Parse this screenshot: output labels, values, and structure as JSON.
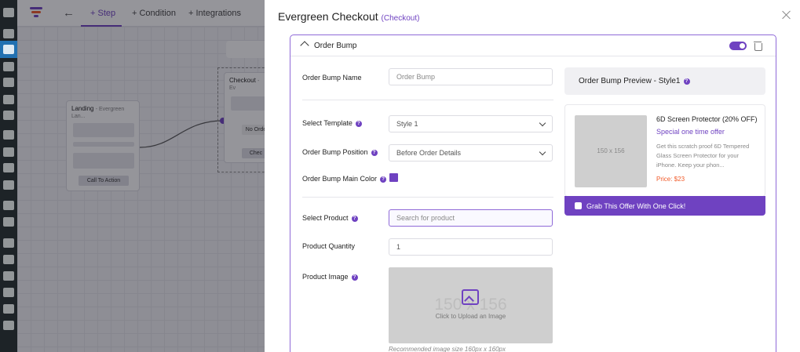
{
  "builder": {
    "tabs": [
      {
        "label": "+ Step",
        "active": true
      },
      {
        "label": "+ Condition",
        "active": false
      },
      {
        "label": "+ Integrations",
        "active": false
      }
    ],
    "landing_node": {
      "title": "Landing",
      "subtitle": "- Evergreen Lan...",
      "button": "Call To Action"
    },
    "checkout_node": {
      "title": "Checkout",
      "subtitle": "- Ev",
      "field1": "No Orde",
      "button": "Chec"
    }
  },
  "drawer": {
    "title": "Evergreen Checkout",
    "subtitle": "(Checkout)",
    "panel": {
      "title": "Order Bump",
      "enabled": true,
      "fields": {
        "name_label": "Order Bump Name",
        "name_placeholder": "Order Bump",
        "template_label": "Select Template",
        "template_value": "Style 1",
        "position_label": "Order Bump Position",
        "position_value": "Before Order Details",
        "color_label": "Order Bump Main Color",
        "color_value": "#6f42c1",
        "product_label": "Select Product",
        "product_placeholder": "Search for product",
        "quantity_label": "Product Quantity",
        "quantity_value": "1",
        "image_label": "Product Image",
        "image_size_text": "150 x 156",
        "image_upload_text": "Click to Upload an Image",
        "image_recommend": "Recommended image size 160px x 160px"
      },
      "preview": {
        "title": "Order Bump Preview - Style1",
        "image_text": "150 x 156",
        "product_name": "6D Screen Protector (20% OFF)",
        "special": "Special one time offer",
        "description": "Get this scratch proof 6D Tempered Glass Screen Protector for your iPhone. Keep your phon...",
        "price": "Price: $23",
        "offer_button": "Grab This Offer With One Click!"
      }
    }
  },
  "colors": {
    "accent": "#6f42c1",
    "price": "#f15a29",
    "wp_sidebar": "#1d2327"
  }
}
